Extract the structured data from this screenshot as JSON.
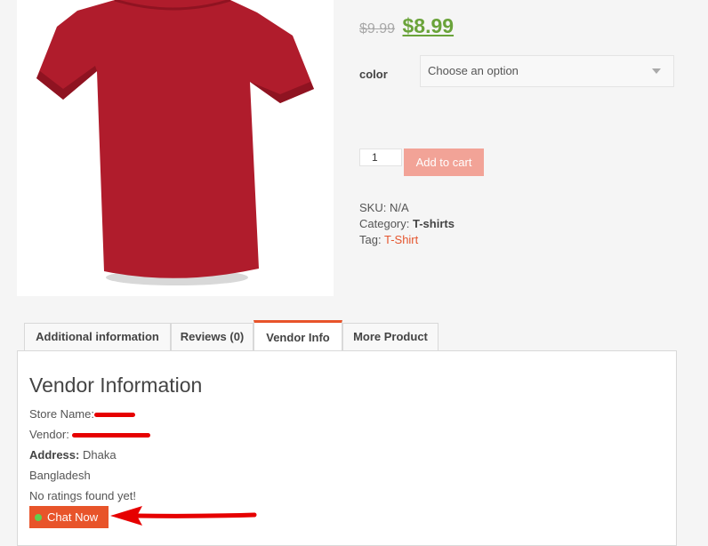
{
  "product": {
    "old_price": "$9.99",
    "new_price": "$8.99",
    "color_label": "color",
    "color_placeholder": "Choose an option",
    "quantity": "1",
    "add_to_cart": "Add to cart",
    "sku_label": "SKU:",
    "sku_value": "N/A",
    "category_label": "Category:",
    "category_value": "T-shirts",
    "tag_label": "Tag:",
    "tag_value": "T-Shirt"
  },
  "tabs": [
    {
      "label": "Additional information"
    },
    {
      "label": "Reviews (0)"
    },
    {
      "label": "Vendor Info"
    },
    {
      "label": "More Product"
    }
  ],
  "vendor": {
    "title": "Vendor Information",
    "store_label": "Store Name:",
    "vendor_label": "Vendor:",
    "address_label": "Address:",
    "address_city": "Dhaka",
    "address_country": "Bangladesh",
    "ratings": "No ratings found yet!",
    "chat_label": "Chat Now"
  },
  "colors": {
    "accent": "#e8542a",
    "price": "#6aa33a",
    "add_to_cart_bg": "#f2a397",
    "shirt": "#b01c2c"
  }
}
